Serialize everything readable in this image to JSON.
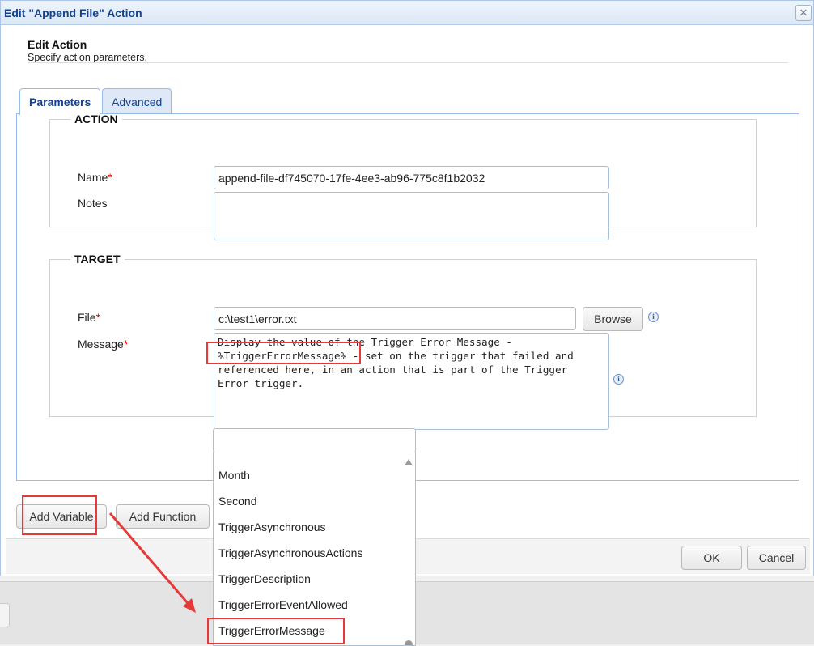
{
  "window": {
    "title": "Edit \"Append File\" Action",
    "close_glyph": "✕"
  },
  "header": {
    "title": "Edit Action",
    "subtitle": "Specify action parameters."
  },
  "tabs": [
    {
      "label": "Parameters"
    },
    {
      "label": "Advanced"
    }
  ],
  "action_group": {
    "legend": "ACTION",
    "name_label": "Name",
    "name_value": "append-file-df745070-17fe-4ee3-ab96-775c8f1b2032",
    "notes_label": "Notes",
    "notes_value": ""
  },
  "target_group": {
    "legend": "TARGET",
    "file_label": "File",
    "file_value": "c:\\test1\\error.txt",
    "browse_label": "Browse",
    "message_label": "Message",
    "message_value": "Display the value of the Trigger Error Message -\n%TriggerErrorMessage% - set on the trigger that failed and\nreferenced here, in an action that is part of the Trigger\nError trigger."
  },
  "required_mark": "*",
  "info_glyph": "i",
  "buttons": {
    "add_variable": "Add Variable",
    "add_function": "Add Function",
    "ok": "OK",
    "cancel": "Cancel"
  },
  "variable_dropdown": {
    "search_value": "",
    "items": [
      "Month",
      "Second",
      "TriggerAsynchronous",
      "TriggerAsynchronousActions",
      "TriggerDescription",
      "TriggerErrorEventAllowed",
      "TriggerErrorMessage"
    ],
    "highlighted_item": "TriggerErrorMessage"
  },
  "colors": {
    "annotation_red": "#e63a3a",
    "accent_blue": "#15428b",
    "border_blue": "#99bbe8"
  }
}
